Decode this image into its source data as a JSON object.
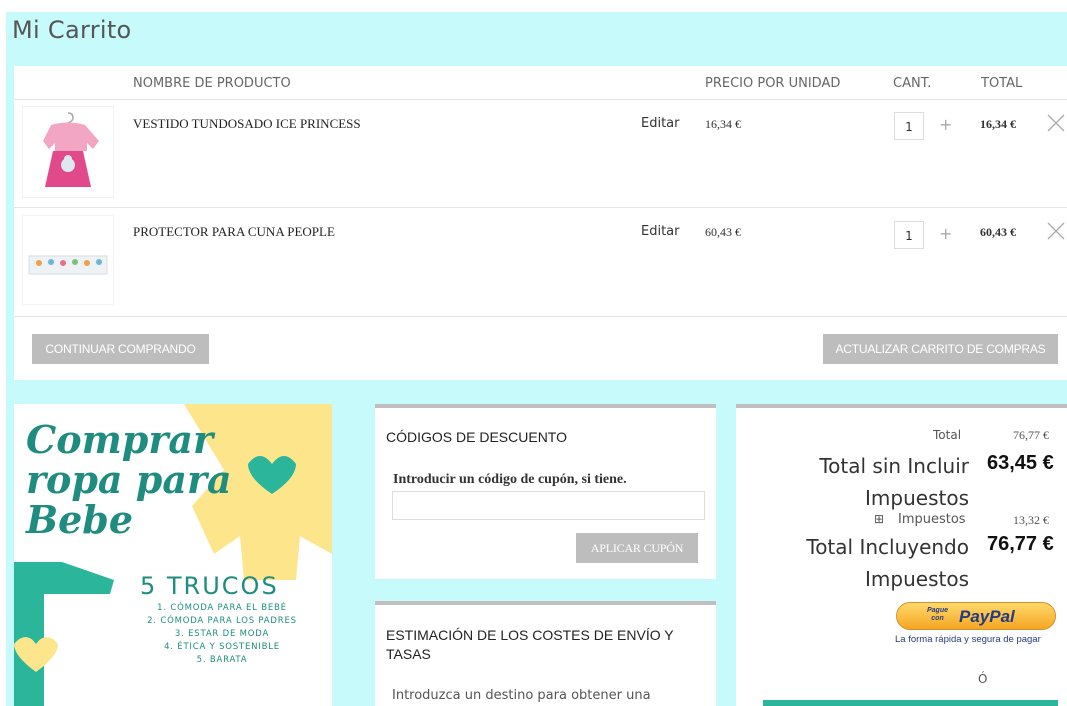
{
  "page": {
    "title": "Mi Carrito"
  },
  "table": {
    "headers": {
      "product": "NOMBRE DE PRODUCTO",
      "unit_price": "PRECIO POR UNIDAD",
      "qty": "CANT.",
      "total": "TOTAL"
    },
    "rows": [
      {
        "name": "VESTIDO TUNDOSADO ICE PRINCESS",
        "edit": "Editar",
        "unit_price": "16,34 €",
        "qty": "1",
        "plus": "+",
        "total": "16,34 €"
      },
      {
        "name": "PROTECTOR PARA CUNA PEOPLE",
        "edit": "Editar",
        "unit_price": "60,43 €",
        "qty": "1",
        "plus": "+",
        "total": "60,43 €"
      }
    ]
  },
  "actions": {
    "continue": "CONTINUAR COMPRANDO",
    "update": "ACTUALIZAR CARRITO DE COMPRAS"
  },
  "promo": {
    "line1": "Comprar",
    "line2": "ropa para",
    "line3": "Bebe",
    "heading": "5 TRUCOS",
    "tips": [
      "1. CÓMODA PARA EL BEBÉ",
      "2. CÓMODA PARA LOS PADRES",
      "3. ESTAR DE MODA",
      "4. ÉTICA Y SOSTENIBLE",
      "5. BARATA"
    ]
  },
  "discount": {
    "title": "CÓDIGOS DE DESCUENTO",
    "label": "Introducir un código de cupón, si tiene.",
    "input_value": "",
    "apply": "APLICAR CUPÓN"
  },
  "shipping": {
    "title": "ESTIMACIÓN DE LOS COSTES DE ENVÍO Y TASAS",
    "intro": "Introduzca un destino para obtener una"
  },
  "totals": {
    "total_label": "Total",
    "total_value": "76,77 €",
    "excl_label_1": "Total sin Incluir",
    "excl_label_2": "Impuestos",
    "excl_value": "63,45 €",
    "tax_toggle": "⊞",
    "tax_label": "Impuestos",
    "tax_value": "13,32 €",
    "incl_label_1": "Total Incluyendo",
    "incl_label_2": "Impuestos",
    "incl_value": "76,77 €",
    "paypal_small_1": "Pague",
    "paypal_small_2": "con",
    "paypal_brand": "PayPal",
    "paypal_tagline": "La forma rápida y segura de pagar",
    "or": "Ó"
  },
  "colors": {
    "band": "#c7fbfb",
    "button_gray": "#bdbdbd",
    "teal": "#1e8c7e",
    "yellow": "#fde58c",
    "green": "#2bb59a",
    "paypal_navy": "#253b80",
    "paypal_blue": "#179bd7"
  }
}
